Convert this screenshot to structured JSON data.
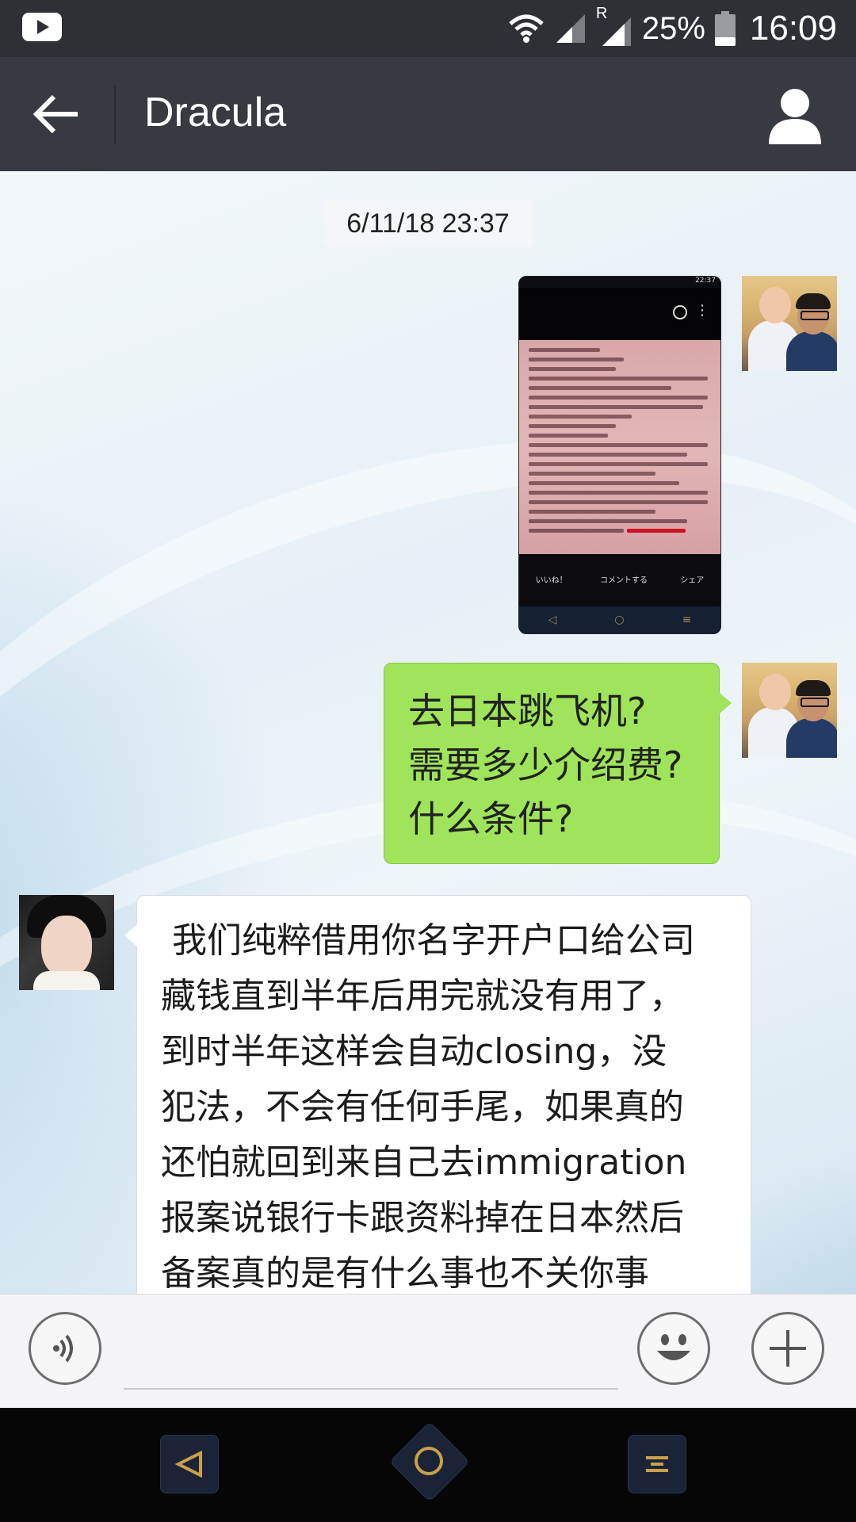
{
  "status_bar": {
    "notification_icon": "youtube-icon",
    "signal_roaming_label": "R",
    "battery": "25%",
    "time": "16:09"
  },
  "header": {
    "back_icon": "arrow-left-icon",
    "title": "Dracula",
    "profile_icon": "person-icon"
  },
  "chat": {
    "timestamp": "6/11/18 23:37",
    "messages": [
      {
        "sender": "me",
        "type": "image",
        "screenshot_status_time": "22:37",
        "screenshot_actions": [
          "いいね！",
          "コメントする",
          "シェア"
        ]
      },
      {
        "sender": "me",
        "type": "text",
        "lines": [
          "去日本跳飞机?",
          "需要多少介绍费?",
          "什么条件?"
        ]
      },
      {
        "sender": "Dracula",
        "type": "text",
        "lines": [
          " 我们纯粹借用你名字开户口给公司",
          "藏钱直到半年后用完就没有用了，",
          "到时半年这样会自动closing，没",
          "犯法，不会有任何手尾，如果真的",
          "还怕就回到来自己去immigration",
          "报案说银行卡跟资料掉在日本然后",
          "备案真的是有什么事也不关你事"
        ]
      }
    ]
  },
  "input_bar": {
    "voice_icon": "voice-icon",
    "emoji_icon": "emoji-icon",
    "add_icon": "plus-icon"
  },
  "nav_bar": {
    "back_icon": "nav-back-icon",
    "home_icon": "nav-home-icon",
    "menu_icon": "nav-menu-icon"
  },
  "colors": {
    "status_bar": "#2e3035",
    "title_bar": "#373a41",
    "my_bubble": "#9fe45a",
    "other_bubble": "#ffffff",
    "nav_accent": "#c9a14a"
  }
}
